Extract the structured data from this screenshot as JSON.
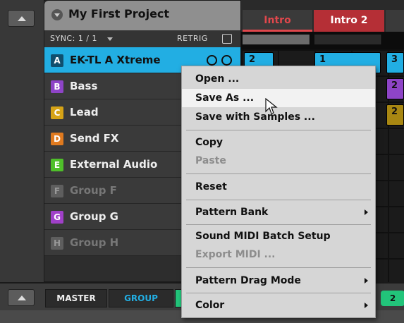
{
  "project": {
    "title": "My First Project"
  },
  "sync": {
    "label": "SYNC: 1 / 1",
    "retrig_label": "RETRIG"
  },
  "groups": [
    {
      "letter": "A",
      "name": "EK-TL A Xtreme",
      "color": "#0f4f6e",
      "selected": true
    },
    {
      "letter": "B",
      "name": "Bass",
      "color": "#8e44c7"
    },
    {
      "letter": "C",
      "name": "Lead",
      "color": "#d6a316"
    },
    {
      "letter": "D",
      "name": "Send FX",
      "color": "#e07a1f"
    },
    {
      "letter": "E",
      "name": "External Audio",
      "color": "#4fbf2a"
    },
    {
      "letter": "F",
      "name": "Group F",
      "color": "#5e5e5e",
      "dim": true
    },
    {
      "letter": "G",
      "name": "Group G",
      "color": "#a040c8"
    },
    {
      "letter": "H",
      "name": "Group H",
      "color": "#5e5e5e",
      "dim": true
    }
  ],
  "patterns": {
    "scenes": [
      {
        "label": "Intro",
        "color": "#e0474c"
      },
      {
        "label": "Intro 2",
        "color": "#e0474c"
      }
    ],
    "clips": [
      {
        "label": "2",
        "color": "#22aee3"
      },
      {
        "label": "1",
        "color": "#22aee3"
      },
      {
        "label": "3",
        "color": "#22aee3"
      },
      {
        "label": "2",
        "color": "#8e44c7"
      },
      {
        "label": "2",
        "color": "#d6a316"
      }
    ]
  },
  "bottom": {
    "master_label": "MASTER",
    "group_label": "GROUP",
    "right_pill": "2"
  },
  "context_menu": {
    "items": [
      {
        "label": "Open ...",
        "enabled": true
      },
      {
        "label": "Save As ...",
        "enabled": true,
        "highlighted": true
      },
      {
        "label": "Save with Samples ...",
        "enabled": true
      },
      {
        "label": "Copy",
        "enabled": true
      },
      {
        "label": "Paste",
        "enabled": false
      },
      {
        "label": "Reset",
        "enabled": true
      },
      {
        "label": "Pattern Bank",
        "enabled": true,
        "submenu": true
      },
      {
        "label": "Sound MIDI Batch Setup",
        "enabled": true
      },
      {
        "label": "Export MIDI ...",
        "enabled": false
      },
      {
        "label": "Pattern Drag Mode",
        "enabled": true,
        "submenu": true
      },
      {
        "label": "Color",
        "enabled": true,
        "submenu": true
      }
    ]
  },
  "icons": [
    "chevron-up-icon",
    "dropdown-arrow-icon",
    "mouse-pointer-icon",
    "submenu-arrow-icon"
  ]
}
